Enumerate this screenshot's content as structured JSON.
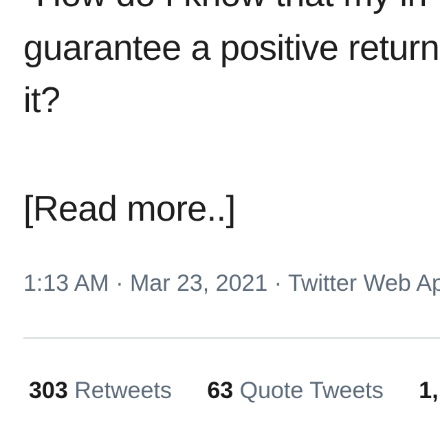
{
  "tweet": {
    "text_lines": [
      "\"How do I know that my in",
      "guarantee a positive return",
      "it?"
    ],
    "read_more": "[Read more..]",
    "time": "1:13 AM",
    "separator": " · ",
    "date": "Mar 23, 2021",
    "source": "Twitter Web Ap"
  },
  "stats": {
    "retweets": {
      "count": "303",
      "label": "Retweets"
    },
    "quote_tweets": {
      "count": "63",
      "label": "Quote Tweets"
    },
    "likes": {
      "count": "1,",
      "label": ""
    }
  },
  "colors": {
    "text": "#1e1e1e",
    "muted": "#5b6b7a",
    "divider": "#dfe3e7"
  }
}
